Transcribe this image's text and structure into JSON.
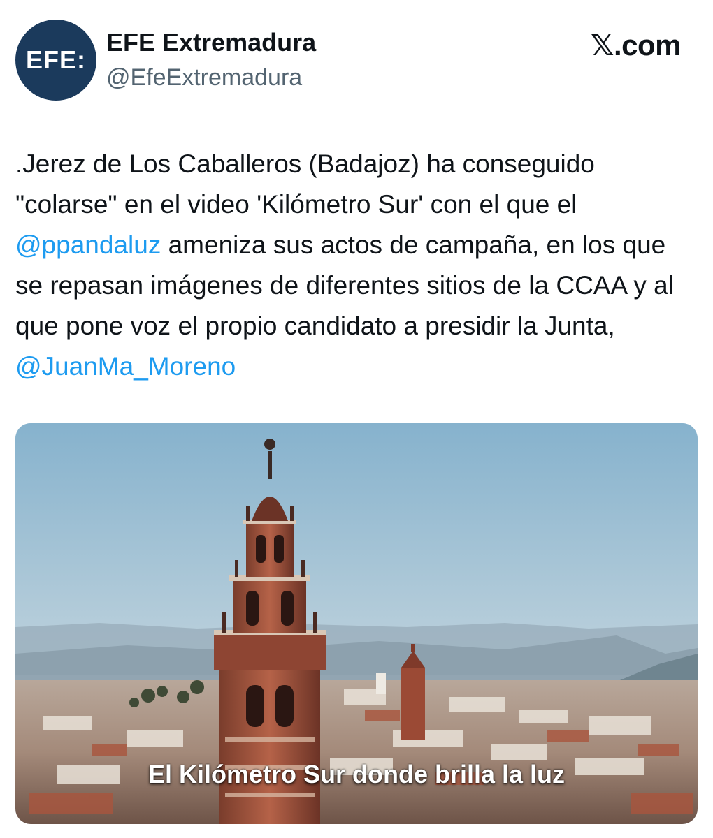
{
  "author": {
    "avatar_text": "EFE:",
    "display_name": "EFE Extremadura",
    "handle": "@EfeExtremadura"
  },
  "brand": {
    "site": "𝕏.com"
  },
  "tweet": {
    "text_part1": ".Jerez de Los Caballeros (Badajoz) ha conseguido \"colarse\" en el video 'Kilómetro Sur' con el que el ",
    "mention1": "@ppandaluz",
    "text_part2": " ameniza sus actos de campaña, en los que se repasan imágenes de diferentes sitios de la CCAA y al que pone voz el propio candidato a presidir la Junta, ",
    "mention2": "@JuanMa_Moreno"
  },
  "media": {
    "caption": "El Kilómetro Sur donde brilla la luz"
  },
  "colors": {
    "accent": "#1d9bf0",
    "avatar_bg": "#1b3a5c",
    "text": "#0f1419",
    "secondary_text": "#536471"
  }
}
